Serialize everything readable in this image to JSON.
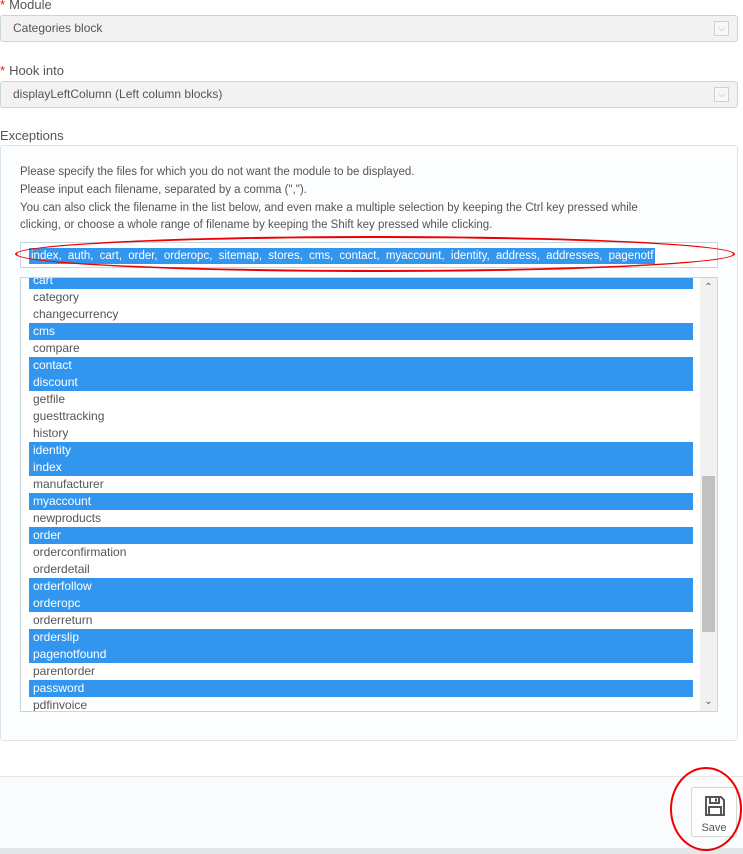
{
  "module": {
    "required_mark": "*",
    "label": "Module",
    "value": "Categories block"
  },
  "hook": {
    "required_mark": "*",
    "label": "Hook into",
    "value": "displayLeftColumn (Left column blocks)"
  },
  "exceptions": {
    "label": "Exceptions",
    "help": [
      "Please specify the files for which you do not want the module to be displayed.",
      "Please input each filename, separated by a comma (\",\").",
      "You can also click the filename in the list below, and even make a multiple selection by keeping the Ctrl key pressed while",
      "clicking, or choose a whole range of filename by keeping the Shift key pressed while clicking."
    ],
    "input_value": "index, auth, cart, order, orderopc, sitemap, stores, cms, contact, myaccount, identity, address, addresses, pagenotf",
    "files": [
      {
        "name": "cart",
        "selected": true
      },
      {
        "name": "category",
        "selected": false
      },
      {
        "name": "changecurrency",
        "selected": false
      },
      {
        "name": "cms",
        "selected": true
      },
      {
        "name": "compare",
        "selected": false
      },
      {
        "name": "contact",
        "selected": true
      },
      {
        "name": "discount",
        "selected": true
      },
      {
        "name": "getfile",
        "selected": false
      },
      {
        "name": "guesttracking",
        "selected": false
      },
      {
        "name": "history",
        "selected": false
      },
      {
        "name": "identity",
        "selected": true
      },
      {
        "name": "index",
        "selected": true
      },
      {
        "name": "manufacturer",
        "selected": false
      },
      {
        "name": "myaccount",
        "selected": true
      },
      {
        "name": "newproducts",
        "selected": false
      },
      {
        "name": "order",
        "selected": true
      },
      {
        "name": "orderconfirmation",
        "selected": false
      },
      {
        "name": "orderdetail",
        "selected": false
      },
      {
        "name": "orderfollow",
        "selected": true
      },
      {
        "name": "orderopc",
        "selected": true
      },
      {
        "name": "orderreturn",
        "selected": false
      },
      {
        "name": "orderslip",
        "selected": true
      },
      {
        "name": "pagenotfound",
        "selected": true
      },
      {
        "name": "parentorder",
        "selected": false
      },
      {
        "name": "password",
        "selected": true
      },
      {
        "name": "pdfinvoice",
        "selected": false
      }
    ]
  },
  "footer": {
    "save_label": "Save",
    "save_icon": "floppy-disk-icon"
  },
  "colors": {
    "selection": "#3296ef",
    "required": "#e41b1b",
    "annotation": "#e00000"
  }
}
